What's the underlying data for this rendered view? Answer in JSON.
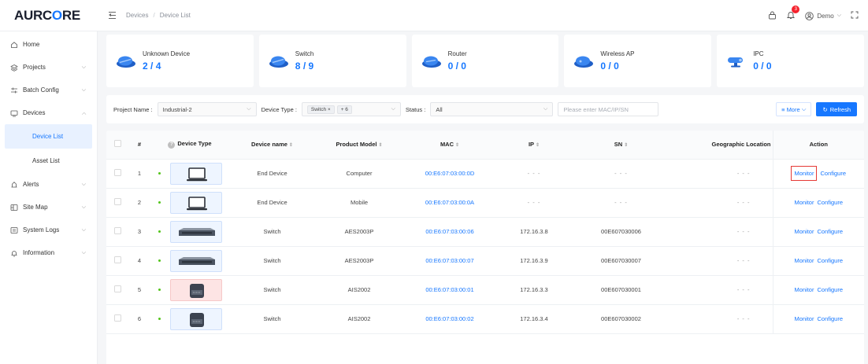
{
  "app": {
    "logo_pre": "AURC",
    "logo_o": "O",
    "logo_post": "RE"
  },
  "breadcrumb": [
    "Devices",
    "/",
    "Device List"
  ],
  "header": {
    "notifications": "3",
    "user": "Demo"
  },
  "sidebar": {
    "items": [
      {
        "label": "Home",
        "icon": "home-icon"
      },
      {
        "label": "Projects",
        "icon": "projects-icon",
        "expandable": true
      },
      {
        "label": "Batch Config",
        "icon": "batch-config-icon",
        "expandable": true
      },
      {
        "label": "Devices",
        "icon": "devices-icon",
        "expanded": true
      },
      {
        "label": "Alerts",
        "icon": "alerts-icon",
        "expandable": true
      },
      {
        "label": "Site Map",
        "icon": "site-map-icon",
        "expandable": true
      },
      {
        "label": "System Logs",
        "icon": "system-logs-icon",
        "expandable": true
      },
      {
        "label": "Information",
        "icon": "information-icon",
        "expandable": true
      }
    ],
    "sub_items": [
      "Device List",
      "Asset List"
    ]
  },
  "cards": [
    {
      "title": "Unknown Device",
      "online": "2",
      "sep": " / ",
      "total": "4"
    },
    {
      "title": "Switch",
      "online": "8",
      "sep": " / ",
      "total": "9"
    },
    {
      "title": "Router",
      "online": "0",
      "sep": " / ",
      "total": "0"
    },
    {
      "title": "Wireless AP",
      "online": "0",
      "sep": " / ",
      "total": "0"
    },
    {
      "title": "IPC",
      "online": "0",
      "sep": " / ",
      "total": "0"
    }
  ],
  "filters": {
    "project_label": "Project Name :",
    "project_value": "Industrial-2",
    "type_label": "Device Type :",
    "type_tag": "Switch",
    "type_more": "+ 6",
    "status_label": "Status :",
    "status_value": "All",
    "search_placeholder": "Please enter MAC/IP/SN",
    "more_label": "More",
    "refresh_label": "Refresh"
  },
  "table": {
    "headers": {
      "num": "#",
      "type": "Device Type",
      "name": "Device name",
      "model": "Product Model",
      "mac": "MAC",
      "ip": "IP",
      "sn": "SN",
      "geo": "Geographic Location",
      "action": "Action"
    },
    "rows": [
      {
        "num": "1",
        "kind": "computer",
        "name": "End Device",
        "model": "Computer",
        "mac": "00:E6:07:03:00:0D",
        "ip": "- - -",
        "sn": "- - -",
        "geo": "- - -"
      },
      {
        "num": "2",
        "kind": "computer",
        "name": "End Device",
        "model": "Mobile",
        "mac": "00:E6:07:03:00:0A",
        "ip": "- - -",
        "sn": "- - -",
        "geo": "- - -"
      },
      {
        "num": "3",
        "kind": "rack-switch",
        "name": "Switch",
        "model": "AES2003P",
        "mac": "00:E6:07:03:00:06",
        "ip": "172.16.3.8",
        "sn": "00E607030006",
        "geo": "- - -"
      },
      {
        "num": "4",
        "kind": "rack-switch",
        "name": "Switch",
        "model": "AES2003P",
        "mac": "00:E6:07:03:00:07",
        "ip": "172.16.3.9",
        "sn": "00E607030007",
        "geo": "- - -"
      },
      {
        "num": "5",
        "kind": "din-switch-alert",
        "name": "Switch",
        "model": "AIS2002",
        "mac": "00:E6:07:03:00:01",
        "ip": "172.16.3.3",
        "sn": "00E607030001",
        "geo": "- - -"
      },
      {
        "num": "6",
        "kind": "din-switch",
        "name": "Switch",
        "model": "AIS2002",
        "mac": "00:E6:07:03:00:02",
        "ip": "172.16.3.4",
        "sn": "00E607030002",
        "geo": "- - -"
      }
    ],
    "monitor_label": "Monitor",
    "configure_label": "Configure"
  },
  "colors": {
    "accent": "#1677ff",
    "online": "#52c41a",
    "highlight": "#e53935"
  }
}
